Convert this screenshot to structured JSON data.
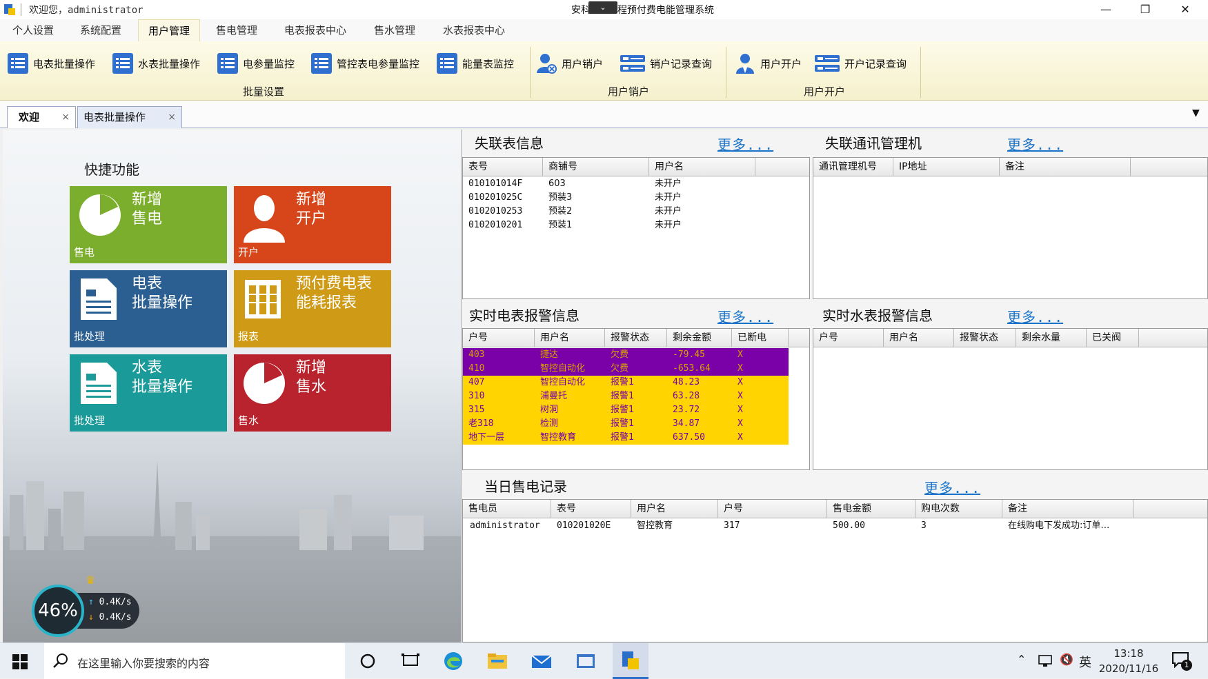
{
  "window": {
    "welcome": "欢迎您，administrator",
    "title_left": "安科",
    "title_right": "程预付费电能管理系统",
    "minimize": "—",
    "restore": "❐",
    "close": "✕"
  },
  "menus": [
    "个人设置",
    "系统配置",
    "用户管理",
    "售电管理",
    "电表报表中心",
    "售水管理",
    "水表报表中心"
  ],
  "ribbon": {
    "buttons": {
      "b1": "电表批量操作",
      "b2": "水表批量操作",
      "b3": "电参量监控",
      "b4": "管控表电参量监控",
      "b5": "能量表监控",
      "b6": "用户销户",
      "b7": "销户记录查询",
      "b8": "用户开户",
      "b9": "开户记录查询"
    },
    "groups": {
      "g1": "批量设置",
      "g2": "用户销户",
      "g3": "用户开户"
    }
  },
  "tabs": {
    "t1": "欢迎",
    "t2": "电表批量操作",
    "close": "×"
  },
  "quick": {
    "title": "快捷功能",
    "tiles": [
      {
        "title": "新增\n售电",
        "sub": "售电",
        "color": "#7cae2e"
      },
      {
        "title": "新增\n开户",
        "sub": "开户",
        "color": "#d7461a"
      },
      {
        "title": "电表\n批量操作",
        "sub": "批处理",
        "color": "#2b5f92"
      },
      {
        "title": "预付费电表\n能耗报表",
        "sub": "报表",
        "color": "#cf9a16"
      },
      {
        "title": "水表\n批量操作",
        "sub": "批处理",
        "color": "#1a9a98"
      },
      {
        "title": "新增\n售水",
        "sub": "售水",
        "color": "#b8232e"
      }
    ]
  },
  "more": "更多...",
  "lost_meters": {
    "title": "失联表信息",
    "headers": [
      "表号",
      "商铺号",
      "用户名"
    ],
    "rows": [
      [
        "010101014F",
        "603",
        "未开户"
      ],
      [
        "010201025C",
        "预装3",
        "未开户"
      ],
      [
        "0102010253",
        "预装2",
        "未开户"
      ],
      [
        "0102010201",
        "预装1",
        "未开户"
      ]
    ]
  },
  "lost_comm": {
    "title": "失联通讯管理机",
    "headers": [
      "通讯管理机号",
      "IP地址",
      "备注"
    ]
  },
  "elec_alarm": {
    "title": "实时电表报警信息",
    "headers": [
      "户号",
      "用户名",
      "报警状态",
      "剩余金额",
      "已断电"
    ],
    "rows": [
      {
        "cells": [
          "403",
          "捷达",
          "欠费",
          "-79.45",
          "X"
        ],
        "color": "#7a00a8",
        "text": "#d6a300"
      },
      {
        "cells": [
          "410",
          "智控自动化",
          "欠费",
          "-653.64",
          "X"
        ],
        "color": "#7a00a8",
        "text": "#d6a300"
      },
      {
        "cells": [
          "407",
          "智控自动化",
          "报警1",
          "48.23",
          "X"
        ],
        "color": "#ffd400",
        "text": "#7a00a8"
      },
      {
        "cells": [
          "310",
          "浦曼托",
          "报警1",
          "63.28",
          "X"
        ],
        "color": "#ffd400",
        "text": "#7a00a8"
      },
      {
        "cells": [
          "315",
          "树洞",
          "报警1",
          "23.72",
          "X"
        ],
        "color": "#ffd400",
        "text": "#7a00a8"
      },
      {
        "cells": [
          "老318",
          "检测",
          "报警1",
          "34.87",
          "X"
        ],
        "color": "#ffd400",
        "text": "#7a00a8"
      },
      {
        "cells": [
          "地下一层",
          "智控教育",
          "报警1",
          "637.50",
          "X"
        ],
        "color": "#ffd400",
        "text": "#7a00a8"
      }
    ]
  },
  "water_alarm": {
    "title": "实时水表报警信息",
    "headers": [
      "户号",
      "用户名",
      "报警状态",
      "剩余水量",
      "已关阀"
    ]
  },
  "sales": {
    "title": "当日售电记录",
    "headers": [
      "售电员",
      "表号",
      "用户名",
      "户号",
      "售电金额",
      "购电次数",
      "备注"
    ],
    "rows": [
      [
        "administrator",
        "010201020E",
        "智控教育",
        "317",
        "500.00",
        "3",
        "在线购电下发成功:订单…"
      ]
    ]
  },
  "speed": {
    "percent": "46%",
    "up": "0.4K/s",
    "down": "0.4K/s",
    "up_arrow": "↑",
    "down_arrow": "↓"
  },
  "taskbar": {
    "search_placeholder": "在这里输入你要搜索的内容",
    "tray_ime": "英",
    "tray_volume": "🔇",
    "time": "13:18",
    "date": "2020/11/16",
    "notif_count": "1"
  }
}
